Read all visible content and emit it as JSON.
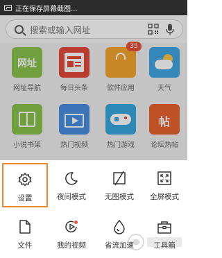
{
  "status_bar": {
    "text": "正在保存屏幕截图..."
  },
  "search": {
    "placeholder": "搜索或输入网址"
  },
  "tiles": [
    {
      "label": "网址导航",
      "icon": "wangzhi-icon",
      "color": "#8cc34b",
      "glyph": "网址"
    },
    {
      "label": "每日头条",
      "icon": "newspaper-icon",
      "color": "#e24a3a",
      "glyph": ""
    },
    {
      "label": "软件应用",
      "icon": "shopping-bag-icon",
      "color": "#f4a52c",
      "glyph": "",
      "badge": "35"
    },
    {
      "label": "天气",
      "icon": "weather-icon",
      "color": "#3fa7e2",
      "glyph": ""
    },
    {
      "label": "小说书架",
      "icon": "book-icon",
      "color": "#8cc34b",
      "glyph": ""
    },
    {
      "label": "热门视频",
      "icon": "video-icon",
      "color": "#4a8fe0",
      "glyph": ""
    },
    {
      "label": "热门游戏",
      "icon": "gamepad-icon",
      "color": "#3aa8e0",
      "glyph": ""
    },
    {
      "label": "论坛热帖",
      "icon": "forum-icon",
      "color": "#e8632e",
      "glyph": "帖"
    }
  ],
  "menu": {
    "items": [
      {
        "label": "设置",
        "icon": "settings-icon"
      },
      {
        "label": "夜间模式",
        "icon": "moon-icon"
      },
      {
        "label": "无图模式",
        "icon": "no-image-icon"
      },
      {
        "label": "全屏模式",
        "icon": "fullscreen-icon"
      },
      {
        "label": "文件",
        "icon": "file-icon"
      },
      {
        "label": "我的视频",
        "icon": "my-video-icon"
      },
      {
        "label": "省流加速",
        "icon": "water-drop-icon"
      },
      {
        "label": "工具箱",
        "icon": "toolbox-icon"
      }
    ],
    "selected_index": 0,
    "highlight_color": "#f0862b"
  }
}
